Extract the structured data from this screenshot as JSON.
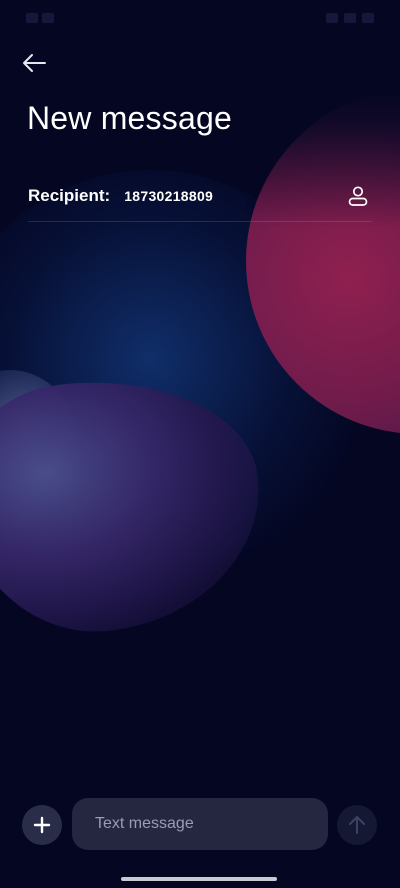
{
  "header": {
    "title": "New message"
  },
  "recipient": {
    "label": "Recipient:",
    "value": "18730218809"
  },
  "compose": {
    "placeholder": "Text message"
  },
  "icons": {
    "back": "arrow-left-icon",
    "contact": "person-icon",
    "add": "plus-icon",
    "send": "arrow-up-icon"
  },
  "colors": {
    "background": "#040622",
    "accent_circle": "#9b2253",
    "input_bg": "#24273f"
  }
}
